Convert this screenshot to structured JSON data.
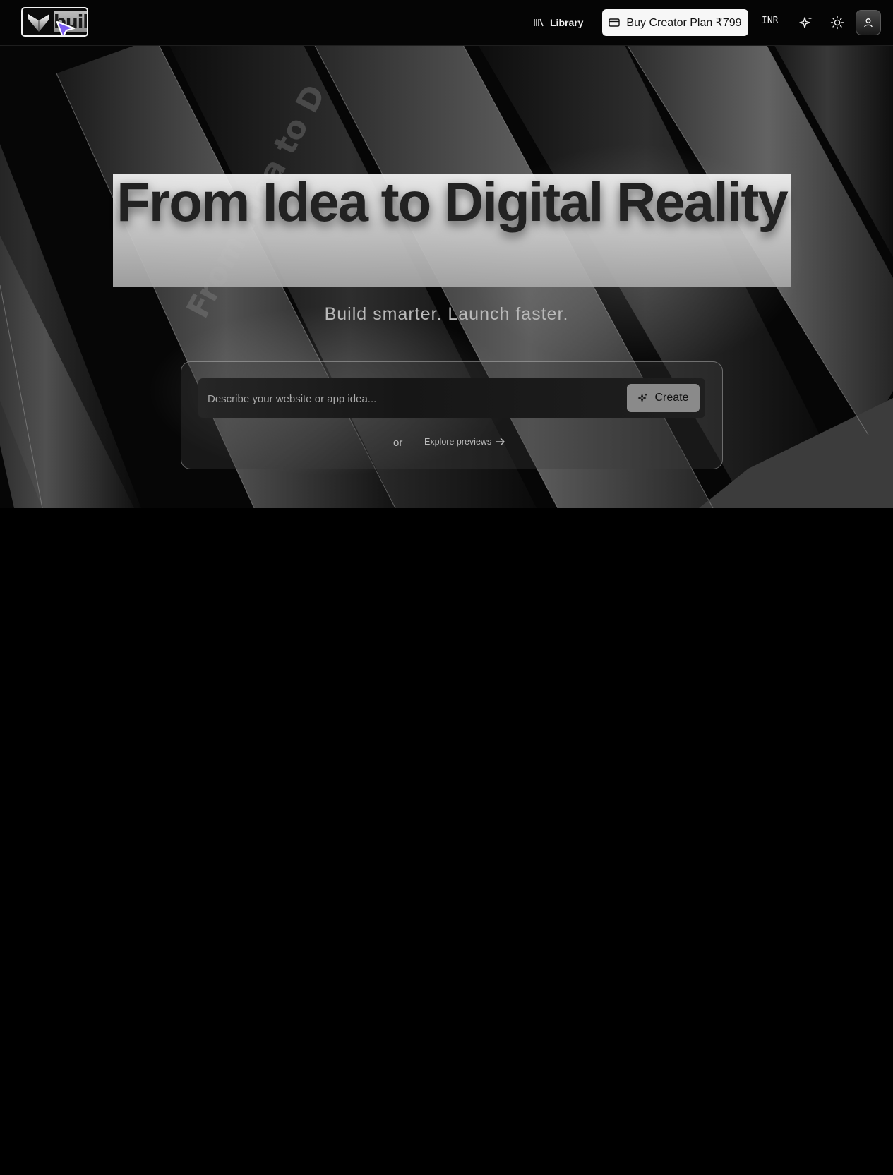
{
  "header": {
    "logo_text": "built",
    "library_label": "Library",
    "buy_button_label": "Buy Creator Plan ₹799",
    "currency": "INR",
    "icons": {
      "logo": "logo-mark-icon",
      "cursor": "cursor-arrow-icon",
      "library": "library-icon",
      "card": "credit-card-icon",
      "sparkle": "sparkle-icon",
      "theme": "sun-icon",
      "user": "user-icon"
    }
  },
  "hero": {
    "title": "From Idea to Digital Reality",
    "subtitle": "Build smarter. Launch faster.",
    "prompt_placeholder": "Describe your website or app idea...",
    "create_label": "Create",
    "or_text": "or",
    "explore_label": "Explore previews",
    "watermark": "From Idea to D"
  },
  "colors": {
    "background": "#000000",
    "buy_button_bg": "#f7f7f7",
    "create_button_bg": "#8a8a8a",
    "cursor_accent": "#7b5cf0"
  }
}
